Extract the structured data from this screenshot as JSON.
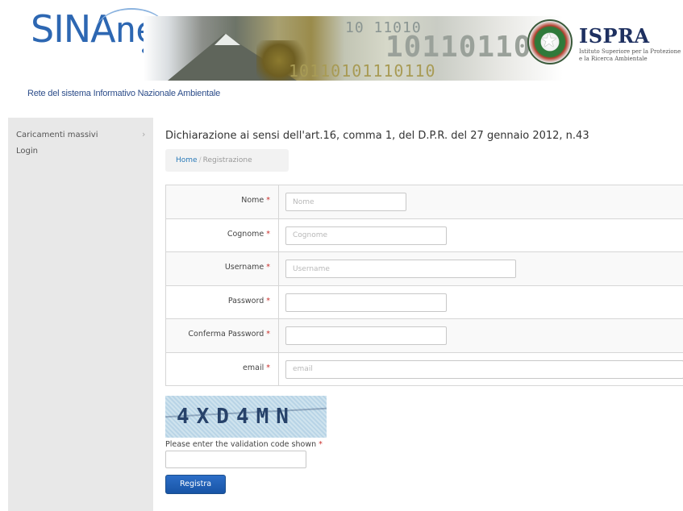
{
  "header": {
    "logo_left": "SINA",
    "logo_right": "net",
    "banner_digits": [
      "10 11010",
      "10110110",
      "10110101110110"
    ],
    "ispra_title": "ISPRA",
    "ispra_sub_line1": "Istituto Superiore per la Protezione",
    "ispra_sub_line2": "e la Ricerca Ambientale",
    "tagline": "Rete del sistema Informativo Nazionale Ambientale"
  },
  "sidebar": {
    "items": [
      {
        "label": "Caricamenti massivi"
      },
      {
        "label": "Login"
      }
    ],
    "chevron": "›"
  },
  "main": {
    "title": "Dichiarazione ai sensi dell'art.16, comma 1, del D.P.R. del 27 gennaio 2012, n.43",
    "breadcrumb": {
      "home": "Home",
      "separator": "/",
      "current": "Registrazione"
    },
    "required_mark": "*",
    "fields": [
      {
        "label": "Nome",
        "placeholder": "Nome",
        "value": ""
      },
      {
        "label": "Cognome",
        "placeholder": "Cognome",
        "value": ""
      },
      {
        "label": "Username",
        "placeholder": "Username",
        "value": ""
      },
      {
        "label": "Password",
        "placeholder": "",
        "value": ""
      },
      {
        "label": "Conferma Password",
        "placeholder": "",
        "value": ""
      },
      {
        "label": "email",
        "placeholder": "email",
        "value": ""
      }
    ],
    "captcha": {
      "code": "4XD4MN",
      "label": "Please enter the validation code shown",
      "value": ""
    },
    "submit_label": "Registra"
  },
  "colors": {
    "brand_blue": "#2d67b2",
    "required_red": "#c9302c",
    "button_blue": "#1854a6",
    "sidebar_bg": "#e8e8e8"
  },
  "icons": {
    "sidebar_chevron": "chevron-right-icon",
    "emblem": "italian-republic-emblem-icon"
  }
}
